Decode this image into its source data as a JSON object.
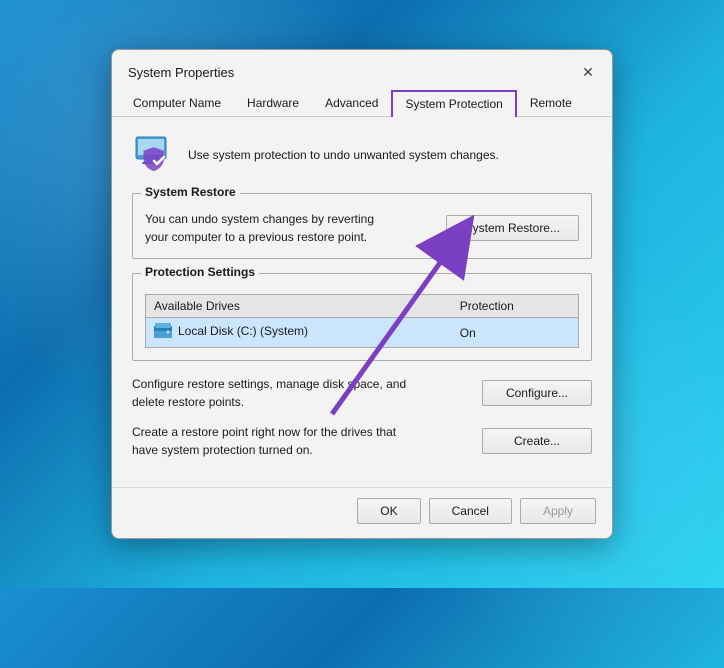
{
  "dialog": {
    "title": "System Properties",
    "close_label": "✕"
  },
  "tabs": [
    {
      "label": "Computer Name",
      "active": false
    },
    {
      "label": "Hardware",
      "active": false
    },
    {
      "label": "Advanced",
      "active": false
    },
    {
      "label": "System Protection",
      "active": true
    },
    {
      "label": "Remote",
      "active": false
    }
  ],
  "intro": {
    "text": "Use system protection to undo unwanted system changes."
  },
  "system_restore": {
    "section_label": "System Restore",
    "description": "You can undo system changes by reverting\nyour computer to a previous restore point.",
    "button_label": "System Restore..."
  },
  "protection_settings": {
    "section_label": "Protection Settings",
    "table": {
      "headers": [
        "Available Drives",
        "Protection"
      ],
      "rows": [
        {
          "drive": "Local Disk (C:) (System)",
          "protection": "On",
          "selected": true
        }
      ]
    }
  },
  "configure_section": {
    "description": "Configure restore settings, manage disk space, and\ndelete restore points.",
    "button_label": "Configure..."
  },
  "create_section": {
    "description": "Create a restore point right now for the drives that\nhave system protection turned on.",
    "button_label": "Create..."
  },
  "footer": {
    "ok_label": "OK",
    "cancel_label": "Cancel",
    "apply_label": "Apply"
  }
}
